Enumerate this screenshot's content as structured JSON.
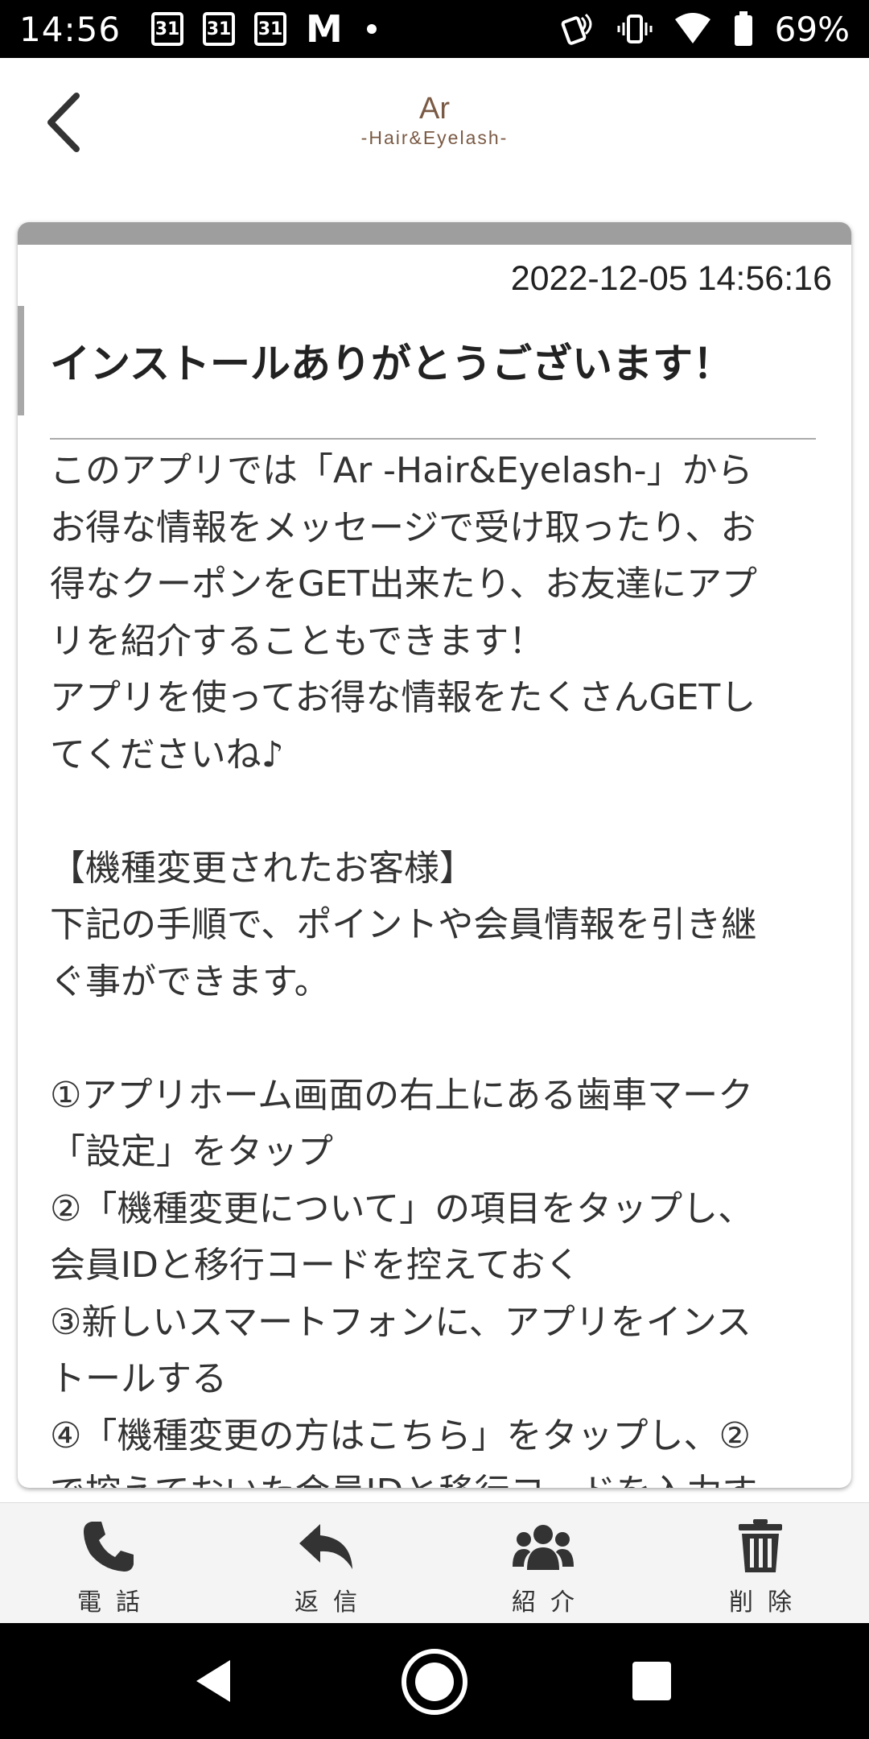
{
  "status_bar": {
    "time": "14:56",
    "calendar_badges": [
      "31",
      "31",
      "31"
    ],
    "mail_glyph": "M",
    "battery": "69%"
  },
  "header": {
    "logo_main": "Ar",
    "logo_sub": "-Hair&Eyelash-"
  },
  "message": {
    "date": "2022-12-05 14:56:16",
    "title": "インストールありがとうございます！",
    "body": "このアプリでは「Ar -Hair&Eyelash-」から\nお得な情報をメッセージで受け取ったり、お\n得なクーポンをGET出来たり、お友達にアプ\nリを紹介することもできます！\nアプリを使ってお得な情報をたくさんGETし\nてくださいね♪\n\n【機種変更されたお客様】\n下記の手順で、ポイントや会員情報を引き継\nぐ事ができます。\n\n①アプリホーム画面の右上にある歯車マーク\n「設定」をタップ\n②「機種変更について」の項目をタップし、\n会員IDと移行コードを控えておく\n③新しいスマートフォンに、アプリをインス\nトールする\n④「機種変更の方はこちら」をタップし、②\nで控えておいた会員IDと移行コードを入力す"
  },
  "toolbar": {
    "phone_label": "電話",
    "reply_label": "返信",
    "introduce_label": "紹介",
    "delete_label": "削除"
  },
  "colors": {
    "logo": "#7a5a44",
    "card_topbar": "#9e9e9e",
    "toolbar_bg": "#f4f4f4"
  }
}
